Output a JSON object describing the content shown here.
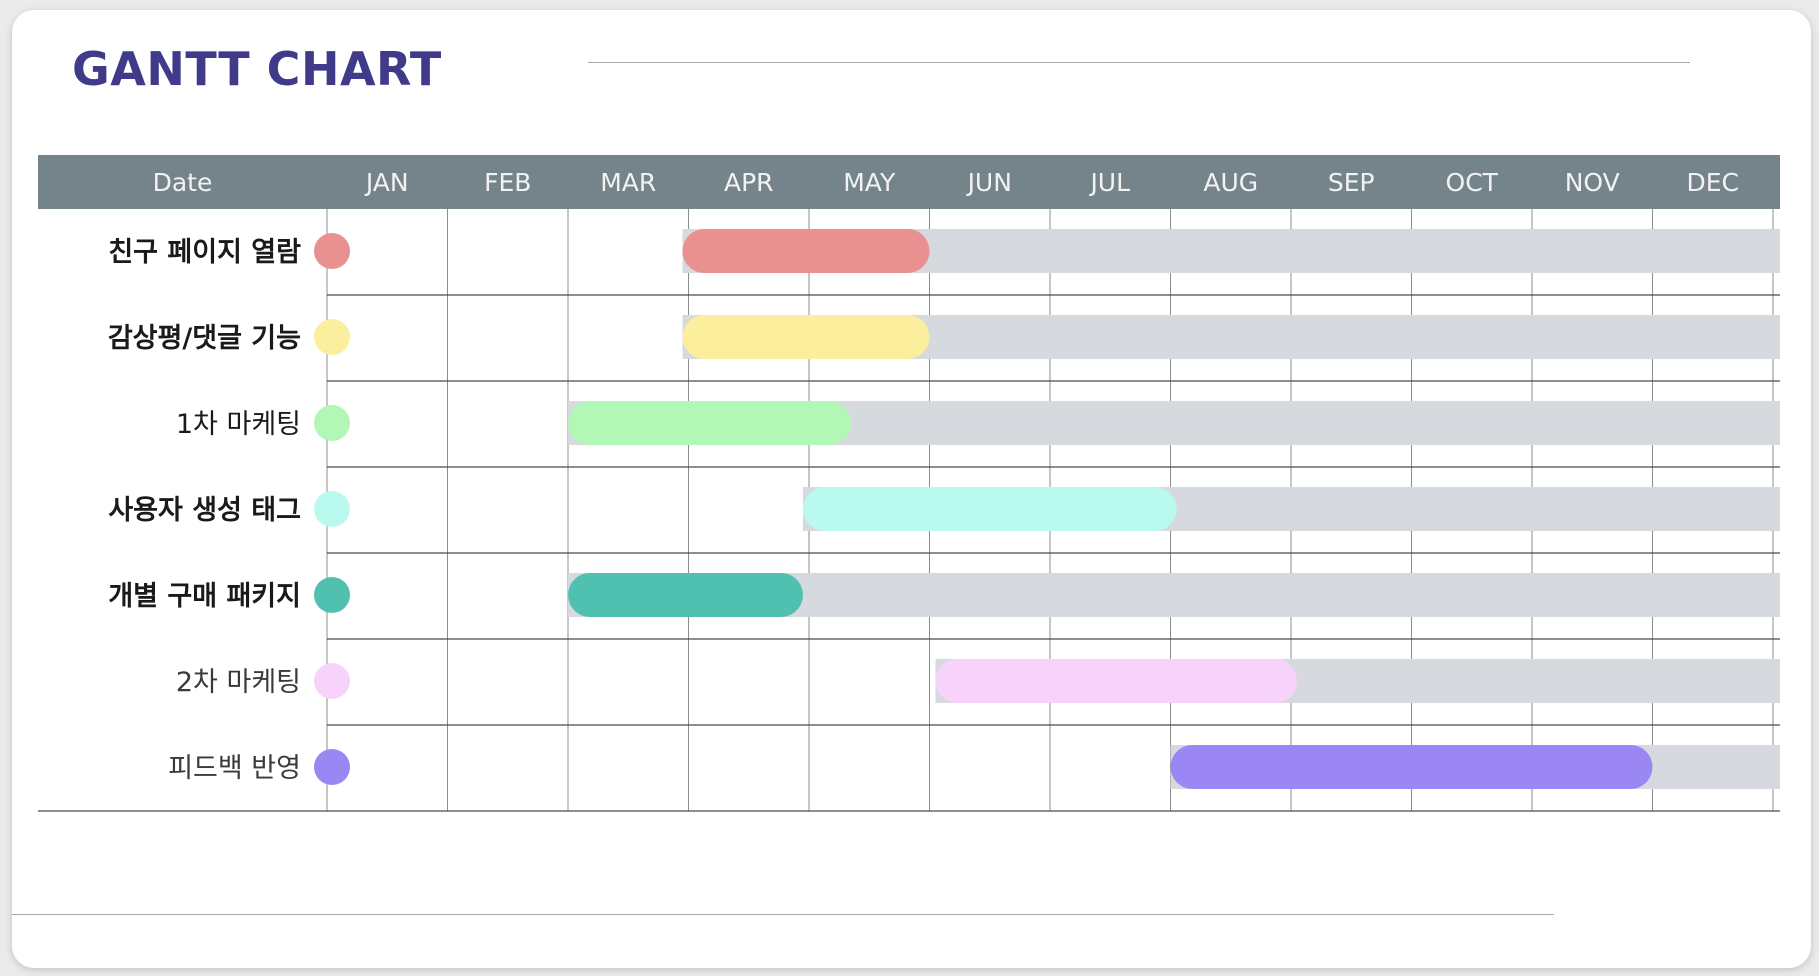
{
  "title": "GANTT CHART",
  "chart_data": {
    "type": "gantt",
    "header_label": "Date",
    "months": [
      "JAN",
      "FEB",
      "MAR",
      "APR",
      "MAY",
      "JUN",
      "JUL",
      "AUG",
      "SEP",
      "OCT",
      "NOV",
      "DEC"
    ],
    "x_range": [
      0,
      12
    ],
    "track_color": "#d6dade",
    "header_color": "#74848a",
    "tasks": [
      {
        "name": "친구 페이지 열람",
        "start": 2.95,
        "end": 5.0,
        "color": "#e99090",
        "weight": "bold"
      },
      {
        "name": "감상평/댓글 기능",
        "start": 2.95,
        "end": 5.0,
        "color": "#fbee9c",
        "weight": "bold"
      },
      {
        "name": "1차 마케팅",
        "start": 2.0,
        "end": 4.35,
        "color": "#b2f7b6",
        "weight": "normal"
      },
      {
        "name": "사용자 생성 태그",
        "start": 3.95,
        "end": 7.05,
        "color": "#bafaee",
        "weight": "bold"
      },
      {
        "name": "개별 구매 패키지",
        "start": 2.0,
        "end": 3.95,
        "color": "#50c1b0",
        "weight": "bold"
      },
      {
        "name": "2차 마케팅",
        "start": 5.05,
        "end": 8.05,
        "color": "#f7d3fb",
        "weight": "light"
      },
      {
        "name": "피드백 반영",
        "start": 7.0,
        "end": 11.0,
        "color": "#9b87f3",
        "weight": "light"
      }
    ]
  }
}
